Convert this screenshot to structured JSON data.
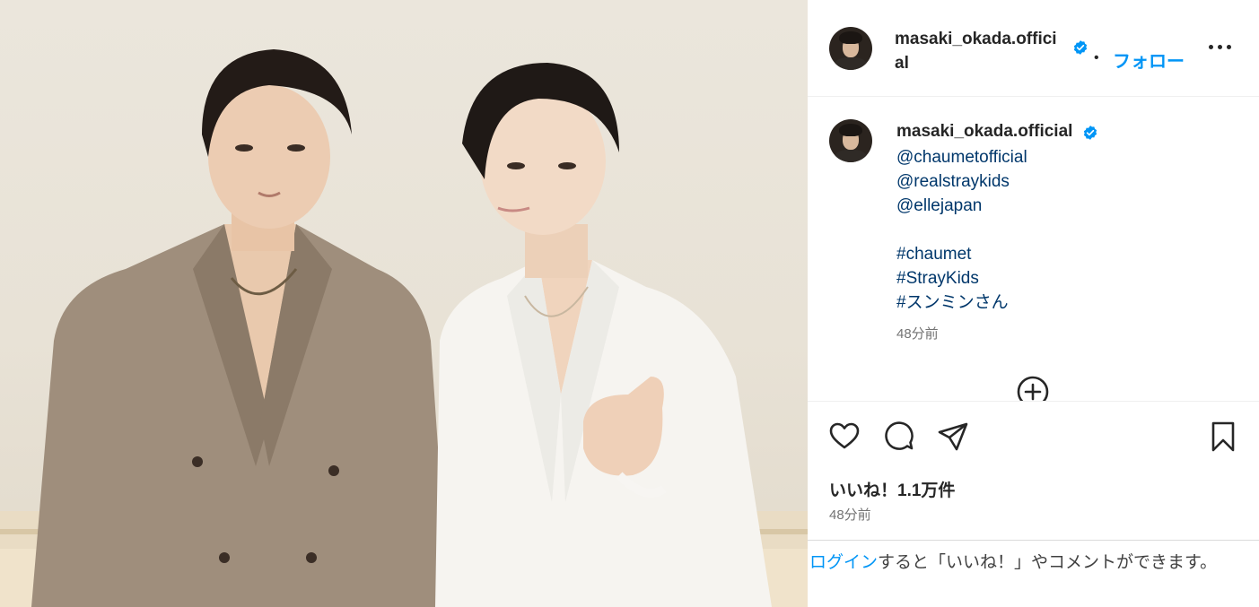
{
  "post": {
    "image_alt": "",
    "author": {
      "username": "masaki_okada.official",
      "verified": true
    },
    "header": {
      "separator": "•",
      "follow_label": "フォロー",
      "more_icon": "more-horizontal-icon"
    },
    "caption": {
      "lines": [
        "@chaumetofficial",
        "@realstraykids",
        "@ellejapan",
        "",
        "#chaumet",
        "#StrayKids",
        "#スンミンさん"
      ],
      "time": "48分前"
    },
    "load_more_icon": "plus-circle-icon",
    "actions": {
      "like_icon": "heart-icon",
      "comment_icon": "comment-icon",
      "share_icon": "send-icon",
      "save_icon": "bookmark-icon"
    },
    "likes_text": "いいね！1.1万件",
    "time": "48分前",
    "login_prompt": {
      "link_text": "ログイン",
      "rest_text": "すると「いいね！」やコメントができます。"
    }
  },
  "colors": {
    "link_blue": "#0095f6",
    "caption_link": "#00376b",
    "verified_blue": "#0095f6",
    "muted_gray": "#737373"
  }
}
